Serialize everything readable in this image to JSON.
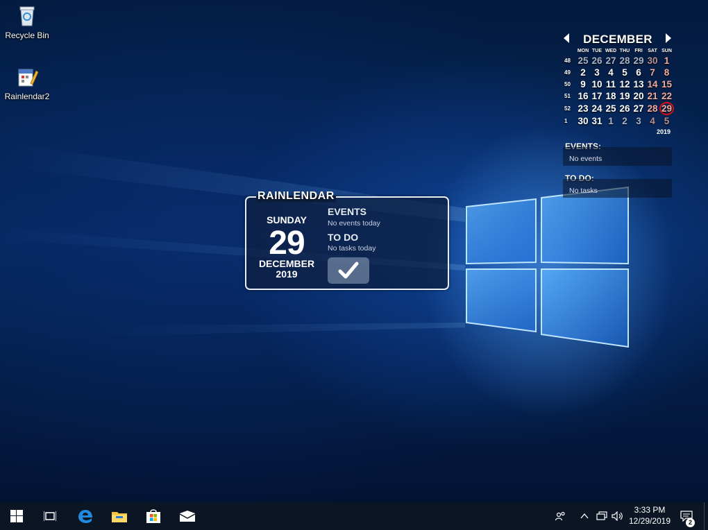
{
  "desktop": {
    "icons": [
      {
        "label": "Recycle Bin",
        "icon": "recycle-bin-icon"
      },
      {
        "label": "Rainlendar2",
        "icon": "rainlendar-icon"
      }
    ]
  },
  "calendar": {
    "month": "DECEMBER",
    "year": "2019",
    "weekdays": [
      "MON",
      "TUE",
      "WED",
      "THU",
      "FRI",
      "SAT",
      "SUN"
    ],
    "weeks": [
      {
        "week": "48",
        "days": [
          "25",
          "26",
          "27",
          "28",
          "29",
          "30",
          "1"
        ]
      },
      {
        "week": "49",
        "days": [
          "2",
          "3",
          "4",
          "5",
          "6",
          "7",
          "8"
        ]
      },
      {
        "week": "50",
        "days": [
          "9",
          "10",
          "11",
          "12",
          "13",
          "14",
          "15"
        ]
      },
      {
        "week": "51",
        "days": [
          "16",
          "17",
          "18",
          "19",
          "20",
          "21",
          "22"
        ]
      },
      {
        "week": "52",
        "days": [
          "23",
          "24",
          "25",
          "26",
          "27",
          "28",
          "29"
        ]
      },
      {
        "week": "1",
        "days": [
          "30",
          "31",
          "1",
          "2",
          "3",
          "4",
          "5"
        ]
      }
    ],
    "today": "29",
    "colors": {
      "weekend": "#f3a99c",
      "today_ring": "#e01010"
    }
  },
  "events_panel": {
    "title": "EVENTS:",
    "text": "No events"
  },
  "todo_panel": {
    "title": "TO DO:",
    "text": "No tasks"
  },
  "widget": {
    "brand": "RAINLENDAR",
    "day_name": "SUNDAY",
    "day_number": "29",
    "month_name": "DECEMBER",
    "year": "2019",
    "events_title": "EVENTS",
    "events_text": "No events today",
    "todo_title": "TO DO",
    "todo_text": "No tasks today",
    "check_icon": "checkmark-icon"
  },
  "taskbar": {
    "buttons": [
      "start-icon",
      "task-view-icon",
      "edge-icon",
      "file-explorer-icon",
      "store-icon",
      "mail-icon"
    ],
    "tray": [
      "people-icon",
      "chevron-up-icon",
      "network-icon",
      "volume-icon"
    ],
    "time": "3:33 PM",
    "date": "12/29/2019",
    "notification_count": "2"
  }
}
